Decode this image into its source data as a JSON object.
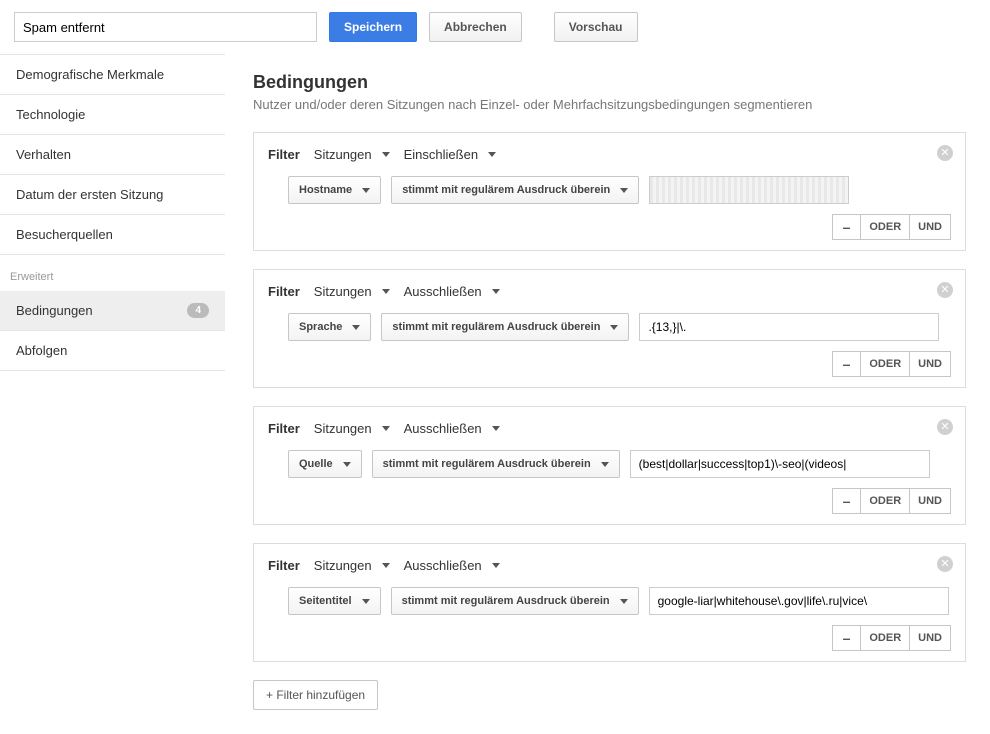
{
  "header": {
    "segment_name": "Spam entfernt",
    "save": "Speichern",
    "cancel": "Abbrechen",
    "preview": "Vorschau"
  },
  "sidebar": {
    "items": [
      "Demografische Merkmale",
      "Technologie",
      "Verhalten",
      "Datum der ersten Sitzung",
      "Besucherquellen"
    ],
    "advanced_heading": "Erweitert",
    "adv_items": [
      {
        "label": "Bedingungen",
        "badge": "4",
        "active": true
      },
      {
        "label": "Abfolgen"
      }
    ]
  },
  "content": {
    "title": "Bedingungen",
    "subtitle": "Nutzer und/oder deren Sitzungen nach Einzel- oder Mehrfachsitzungsbedingungen segmentieren",
    "filter_label": "Filter",
    "sessions": "Sitzungen",
    "include": "Einschließen",
    "exclude": "Ausschließen",
    "match_regex": "stimmt mit regulärem Ausdruck überein",
    "or": "ODER",
    "and": "UND",
    "minus": "–",
    "add_filter": "+ Filter hinzufügen",
    "filters": [
      {
        "mode": "Einschließen",
        "dim": "Hostname",
        "val": "",
        "blur": true
      },
      {
        "mode": "Ausschließen",
        "dim": "Sprache",
        "val": ".{13,}|\\."
      },
      {
        "mode": "Ausschließen",
        "dim": "Quelle",
        "val": "(best|dollar|success|top1)\\-seo|(videos|"
      },
      {
        "mode": "Ausschließen",
        "dim": "Seitentitel",
        "val": "google-liar|whitehouse\\.gov|life\\.ru|vice\\"
      }
    ]
  }
}
